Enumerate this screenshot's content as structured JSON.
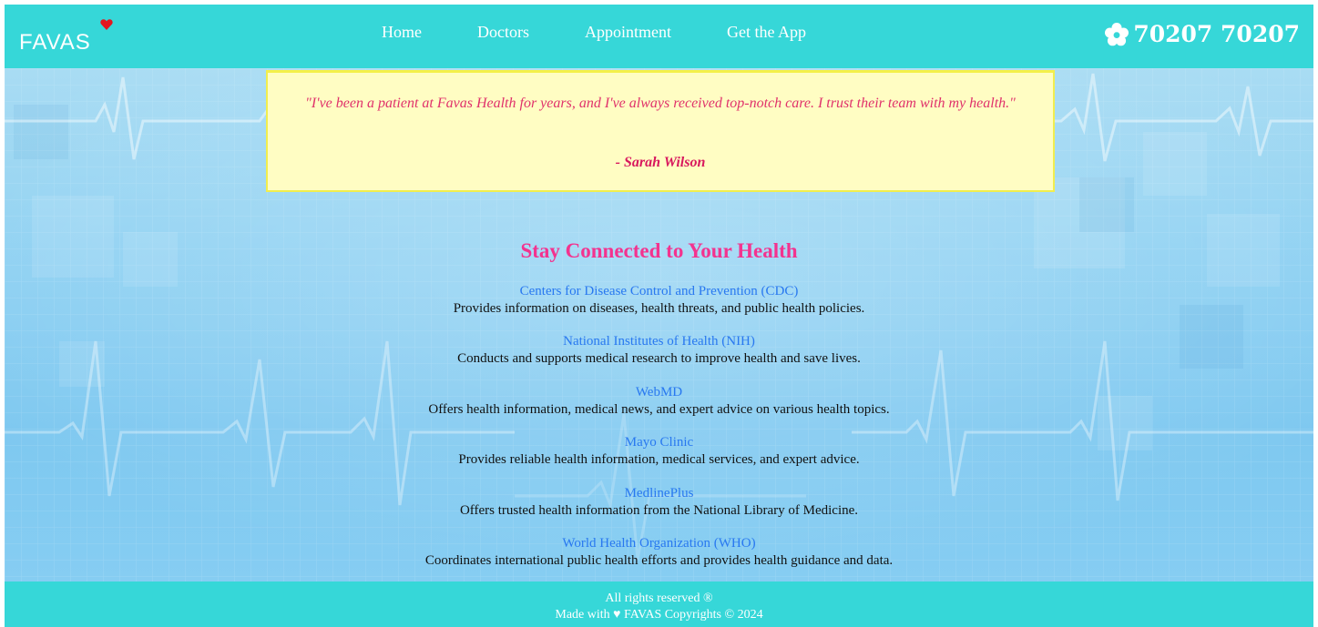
{
  "brand": {
    "logo_text": "FAVAS",
    "accent_color": "#36d7d8",
    "heart_color": "#e3161f"
  },
  "nav": {
    "items": [
      {
        "label": "Home"
      },
      {
        "label": "Doctors"
      },
      {
        "label": "Appointment"
      },
      {
        "label": "Get the App"
      }
    ]
  },
  "contact": {
    "icon": "flower-icon",
    "phone": "70207 70207"
  },
  "testimonial": {
    "quote": "\"I've been a patient at Favas Health for years, and I've always received top-notch care. I trust their team with my health.\"",
    "author": "- Sarah Wilson"
  },
  "resources_section": {
    "title": "Stay Connected to Your Health",
    "items": [
      {
        "name": "Centers for Disease Control and Prevention (CDC)",
        "description": "Provides information on diseases, health threats, and public health policies."
      },
      {
        "name": "National Institutes of Health (NIH)",
        "description": "Conducts and supports medical research to improve health and save lives."
      },
      {
        "name": "WebMD",
        "description": "Offers health information, medical news, and expert advice on various health topics."
      },
      {
        "name": "Mayo Clinic",
        "description": "Provides reliable health information, medical services, and expert advice."
      },
      {
        "name": "MedlinePlus",
        "description": "Offers trusted health information from the National Library of Medicine."
      },
      {
        "name": "World Health Organization (WHO)",
        "description": "Coordinates international public health efforts and provides health guidance and data."
      }
    ]
  },
  "footer": {
    "rights": "All rights reserved ®",
    "made_with": "Made with ♥ FAVAS Copyrights © 2024"
  }
}
